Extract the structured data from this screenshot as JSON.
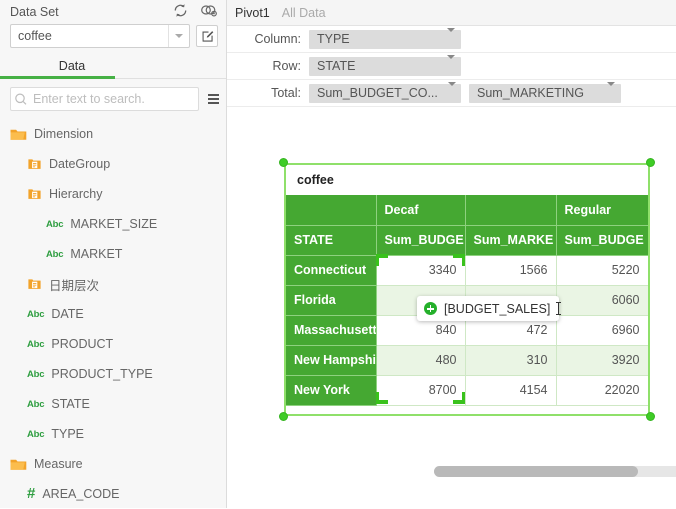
{
  "left_panel": {
    "dataset_label": "Data Set",
    "dataset_value": "coffee",
    "refresh_icon": "refresh-icon",
    "relation_icon": "dataset-relation-icon",
    "edit_icon": "edit-pencil-icon",
    "tab_label": "Data",
    "search_placeholder": "Enter text to search.",
    "menu_icon": "list-menu-icon",
    "tree": [
      {
        "label": "Dimension",
        "level": 0,
        "icon": "folder-icon"
      },
      {
        "label": "DateGroup",
        "level": 1,
        "icon": "hierarchy-folder-icon"
      },
      {
        "label": "Hierarchy",
        "level": 1,
        "icon": "hierarchy-folder-icon"
      },
      {
        "label": "MARKET_SIZE",
        "level": 2,
        "icon": "abc-icon"
      },
      {
        "label": "MARKET",
        "level": 2,
        "icon": "abc-icon"
      },
      {
        "label": "日期层次",
        "level": 1,
        "icon": "hierarchy-folder-icon"
      },
      {
        "label": "DATE",
        "level": 1,
        "icon": "abc-icon"
      },
      {
        "label": "PRODUCT",
        "level": 1,
        "icon": "abc-icon"
      },
      {
        "label": "PRODUCT_TYPE",
        "level": 1,
        "icon": "abc-icon"
      },
      {
        "label": "STATE",
        "level": 1,
        "icon": "abc-icon"
      },
      {
        "label": "TYPE",
        "level": 1,
        "icon": "abc-icon"
      },
      {
        "label": "Measure",
        "level": 0,
        "icon": "folder-icon"
      },
      {
        "label": "AREA_CODE",
        "level": 1,
        "icon": "hash-icon"
      }
    ]
  },
  "right_panel": {
    "tabs": [
      {
        "label": "Pivot1",
        "active": true
      },
      {
        "label": "All Data",
        "active": false
      }
    ],
    "shelves": [
      {
        "label": "Column:",
        "pills": [
          "TYPE"
        ]
      },
      {
        "label": "Row:",
        "pills": [
          "STATE"
        ]
      },
      {
        "label": "Total:",
        "pills": [
          "Sum_BUDGET_CO...",
          "Sum_MARKETING"
        ]
      }
    ]
  },
  "pivot": {
    "title": "coffee",
    "group_headers": [
      "",
      "Decaf",
      "",
      "Regular"
    ],
    "column_headers": [
      "STATE",
      "Sum_BUDGE",
      "Sum_MARKE",
      "Sum_BUDGE"
    ],
    "rows": [
      {
        "state": "Connecticut",
        "values": [
          "3340",
          "1566",
          "5220"
        ]
      },
      {
        "state": "Florida",
        "values": [
          "",
          "",
          "6060"
        ]
      },
      {
        "state": "Massachusett",
        "values": [
          "840",
          "472",
          "6960"
        ]
      },
      {
        "state": "New Hampshi",
        "values": [
          "480",
          "310",
          "3920"
        ]
      },
      {
        "state": "New York",
        "values": [
          "8700",
          "4154",
          "22020"
        ]
      }
    ]
  },
  "drag_ghost": {
    "label": "[BUDGET_SALES]",
    "icon": "plus-circle-icon"
  },
  "colors": {
    "header_green": "#45a832",
    "selection_green": "#8fe06a",
    "handle_green": "#3fcc26",
    "alt_row": "#eaf5e4",
    "tab_underline": "#46b145",
    "abc_icon": "#2f9e41",
    "folder_icon": "#f2a32a"
  },
  "chart_data": {
    "type": "table",
    "title": "coffee",
    "columns": [
      "STATE",
      "Decaf / Sum_BUDGE",
      "Decaf / Sum_MARKE",
      "Regular / Sum_BUDGE"
    ],
    "rows": [
      [
        "Connecticut",
        3340,
        1566,
        5220
      ],
      [
        "Florida",
        null,
        null,
        6060
      ],
      [
        "Massachusett",
        840,
        472,
        6960
      ],
      [
        "New Hampshi",
        480,
        310,
        3920
      ],
      [
        "New York",
        8700,
        4154,
        22020
      ]
    ]
  }
}
